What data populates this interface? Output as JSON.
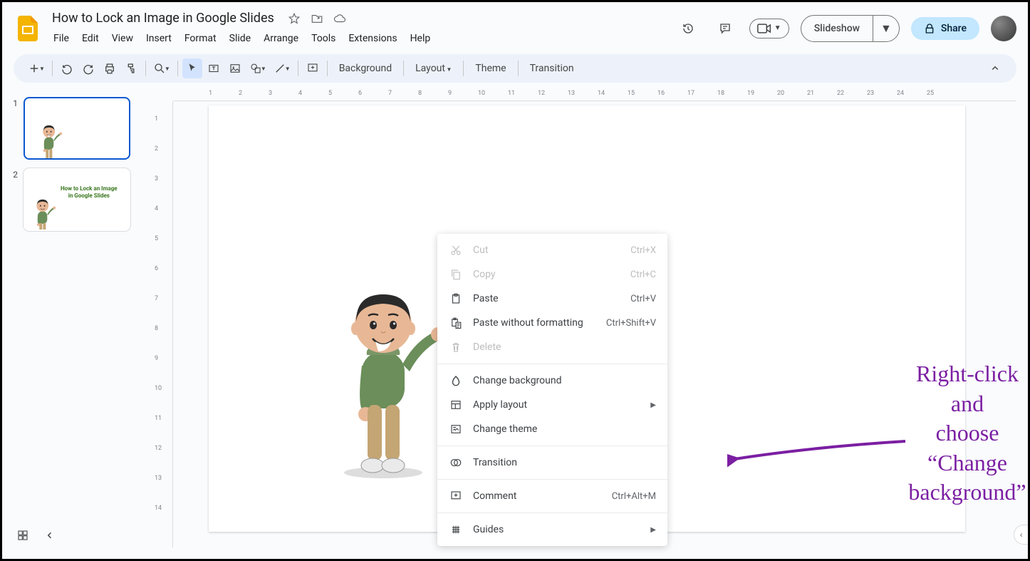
{
  "header": {
    "doc_title": "How to Lock an Image in Google Slides",
    "menus": [
      "File",
      "Edit",
      "View",
      "Insert",
      "Format",
      "Slide",
      "Arrange",
      "Tools",
      "Extensions",
      "Help"
    ],
    "slideshow_label": "Slideshow",
    "share_label": "Share"
  },
  "toolbar": {
    "text_buttons": [
      "Background",
      "Layout",
      "Theme",
      "Transition"
    ]
  },
  "sidebar": {
    "thumbs": [
      {
        "num": "1",
        "selected": true
      },
      {
        "num": "2",
        "selected": false,
        "caption_line1": "How to Lock an Image",
        "caption_line2": "in Google Slides"
      }
    ]
  },
  "ruler_h": [
    "1",
    "2",
    "3",
    "4",
    "5",
    "6",
    "7",
    "8",
    "9",
    "10",
    "11",
    "12",
    "13",
    "14",
    "15",
    "16",
    "17",
    "18",
    "19",
    "20",
    "21",
    "22",
    "23",
    "24",
    "25"
  ],
  "ruler_v": [
    "1",
    "2",
    "3",
    "4",
    "5",
    "6",
    "7",
    "8",
    "9",
    "10",
    "11",
    "12",
    "13",
    "14"
  ],
  "context_menu": {
    "groups": [
      [
        {
          "icon": "cut",
          "label": "Cut",
          "shortcut": "Ctrl+X",
          "disabled": true
        },
        {
          "icon": "copy",
          "label": "Copy",
          "shortcut": "Ctrl+C",
          "disabled": true
        },
        {
          "icon": "paste",
          "label": "Paste",
          "shortcut": "Ctrl+V",
          "disabled": false
        },
        {
          "icon": "paste-plain",
          "label": "Paste without formatting",
          "shortcut": "Ctrl+Shift+V",
          "disabled": false
        },
        {
          "icon": "delete",
          "label": "Delete",
          "shortcut": "",
          "disabled": true
        }
      ],
      [
        {
          "icon": "background",
          "label": "Change background",
          "shortcut": "",
          "disabled": false
        },
        {
          "icon": "layout",
          "label": "Apply layout",
          "shortcut": "",
          "disabled": false,
          "submenu": true
        },
        {
          "icon": "theme",
          "label": "Change theme",
          "shortcut": "",
          "disabled": false
        }
      ],
      [
        {
          "icon": "transition",
          "label": "Transition",
          "shortcut": "",
          "disabled": false
        }
      ],
      [
        {
          "icon": "comment",
          "label": "Comment",
          "shortcut": "Ctrl+Alt+M",
          "disabled": false
        }
      ],
      [
        {
          "icon": "guides",
          "label": "Guides",
          "shortcut": "",
          "disabled": false,
          "submenu": true
        }
      ]
    ]
  },
  "annotation": {
    "line1": "Right-click and",
    "line2": "choose “Change",
    "line3": "background”"
  }
}
